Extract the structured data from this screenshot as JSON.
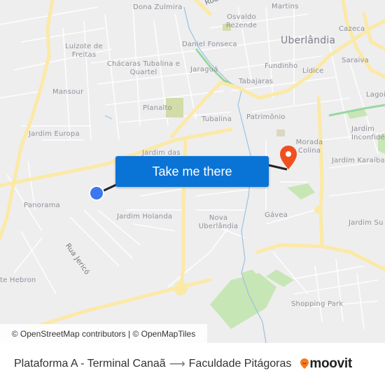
{
  "map": {
    "neighborhoods": [
      {
        "name": "Dona Zulmira"
      },
      {
        "name": "Osvaldo Rezende"
      },
      {
        "name": "Martins"
      },
      {
        "name": "Cazeca"
      },
      {
        "name": "Uberlândia"
      },
      {
        "name": "Luizote de Freitas"
      },
      {
        "name": "Daniel Fonseca"
      },
      {
        "name": "Chácaras Tubalina e Quartel"
      },
      {
        "name": "Jaraguá"
      },
      {
        "name": "Fundinho"
      },
      {
        "name": "Lídice"
      },
      {
        "name": "Saraiva"
      },
      {
        "name": "Mansour"
      },
      {
        "name": "Tabajaras"
      },
      {
        "name": "Lagoi"
      },
      {
        "name": "Planalto"
      },
      {
        "name": "Patrimônio"
      },
      {
        "name": "Tubalina"
      },
      {
        "name": "Jardim Europa"
      },
      {
        "name": "Jardim Inconfidê"
      },
      {
        "name": "Jardim das"
      },
      {
        "name": "Morada Colina"
      },
      {
        "name": "Jardim Karaíba"
      },
      {
        "name": "Panorama"
      },
      {
        "name": "Jardim Holanda"
      },
      {
        "name": "Nova Uberlândia"
      },
      {
        "name": "Gávea"
      },
      {
        "name": "Jardim Su"
      },
      {
        "name": "Rua Jericó"
      },
      {
        "name": "te Hebron"
      },
      {
        "name": "Shopping Park"
      },
      {
        "name": "Rod"
      }
    ],
    "cta_label": "Take me there",
    "attribution": "© OpenStreetMap contributors | © OpenMapTiles",
    "colors": {
      "origin": "#3b78f0",
      "destination": "#f0501e",
      "cta": "#0a74d6",
      "road_major": "#fbe9a6",
      "park": "#c7e6b5"
    }
  },
  "footer": {
    "origin": "Plataforma A - Terminal Canaã",
    "arrow": "⟶",
    "destination": "Faculdade Pitágoras",
    "brand": "moovit"
  }
}
